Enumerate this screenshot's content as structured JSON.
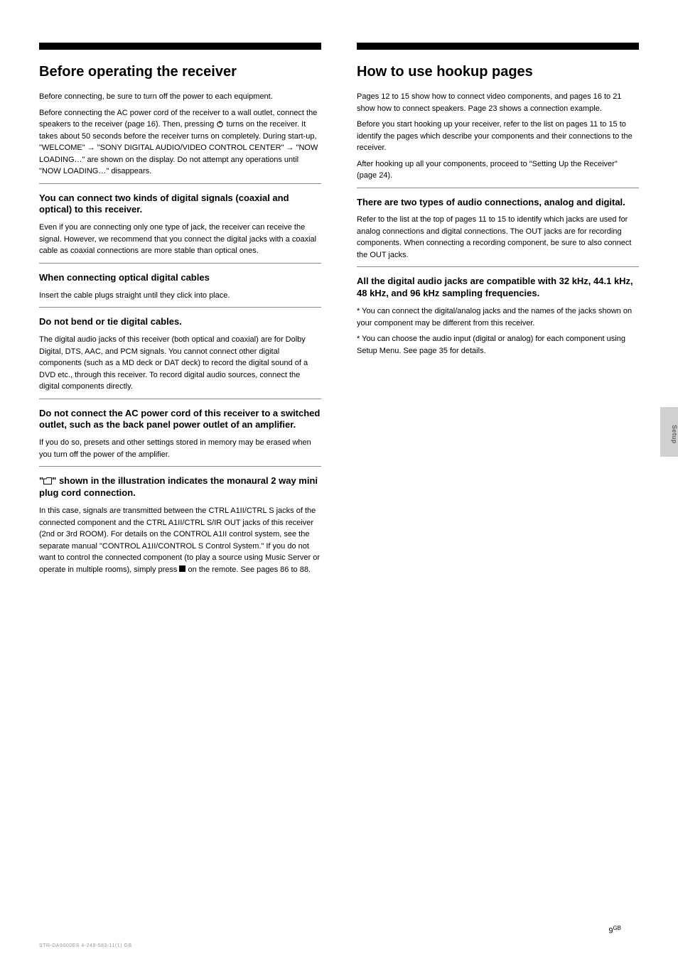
{
  "col1": {
    "title": "Before operating the receiver",
    "p1_a": "Before connecting, be sure to turn off the power to each equipment.",
    "p1_b_pre": "Before connecting the AC power cord of the receiver to a wall outlet, connect the speakers to the receiver (page 16). Then, pressing ",
    "p1_b_post": " turns on the receiver. It takes about 50 seconds before the receiver turns on completely. During start-up, \"WELCOME\" → \"SONY DIGITAL AUDIO/VIDEO CONTROL CENTER\" → \"NOW LOADING…\" are shown on the display. Do not attempt any operations until \"NOW LOADING…\" disappears.",
    "s1": {
      "h": "You can connect two kinds of digital signals (coaxial and optical) to this receiver.",
      "p": "Even if you are connecting only one type of jack, the receiver can receive the signal. However, we recommend that you connect the digital jacks with a coaxial cable as coaxial connections are more stable than optical ones."
    },
    "s2": {
      "h": "When connecting optical digital cables",
      "p": "Insert the cable plugs straight until they click into place."
    },
    "s3": {
      "h": "Do not bend or tie digital cables.",
      "p": "The digital audio jacks of this receiver (both optical and coaxial) are for Dolby Digital, DTS, AAC, and PCM signals. You cannot connect other digital components (such as a MD deck or DAT deck) to record the digital sound of a DVD etc., through this receiver. To record digital audio sources, connect the digital components directly."
    },
    "s4": {
      "h": "Do not connect the AC power cord of this receiver to a switched outlet, such as the back panel power outlet of an amplifier.",
      "p": "If you do so, presets and other settings stored in memory may be erased when you turn off the power of the amplifier."
    },
    "s5": {
      "h_pre": "\"",
      "h_post": "\" shown in the illustration indicates the monaural 2 way mini plug cord connection.",
      "p_pre": "In this case, signals are transmitted between the CTRL A1II/CTRL S jacks of the connected component and the CTRL A1II/CTRL S/IR OUT jacks of this receiver (2nd or 3rd ROOM). For details on the CONTROL A1II control system, see the separate manual \"CONTROL A1II/CONTROL S Control System.\" If you do not want to control the connected component (to play a source using Music Server or operate in multiple rooms), simply press ",
      "p_post": " on the remote. See pages 86 to 88."
    }
  },
  "col2": {
    "title": "How to use hookup pages",
    "p1": "Pages 12 to 15 show how to connect video components, and pages 16 to 21 show how to connect speakers. Page 23 shows a connection example.",
    "p2": "Before you start hooking up your receiver, refer to the list on pages 11 to 15 to identify the pages which describe your components and their connections to the receiver.",
    "p3": "After hooking up all your components, proceed to \"Setting Up the Receiver\" (page 24).",
    "s1": {
      "h": "There are two types of audio connections, analog and digital.",
      "p": "Refer to the list at the top of pages 11 to 15 to identify which jacks are used for analog connections and digital connections. The OUT jacks are for recording components. When connecting a recording component, be sure to also connect the OUT jacks."
    },
    "s2": {
      "h": "All the digital audio jacks are compatible with 32 kHz, 44.1 kHz, 48 kHz, and 96 kHz sampling frequencies.",
      "p1": "* You can connect the digital/analog jacks and the names of the jacks shown on your component may be different from this receiver.",
      "p2": "* You can choose the audio input (digital or analog) for each component using Setup Menu. See page 35 for details."
    }
  },
  "sidetab": "Setup",
  "page_number_main": "9",
  "page_number_sup": "GB",
  "footer": "STR-DA9000ES    4-249-583-11(1) GB"
}
